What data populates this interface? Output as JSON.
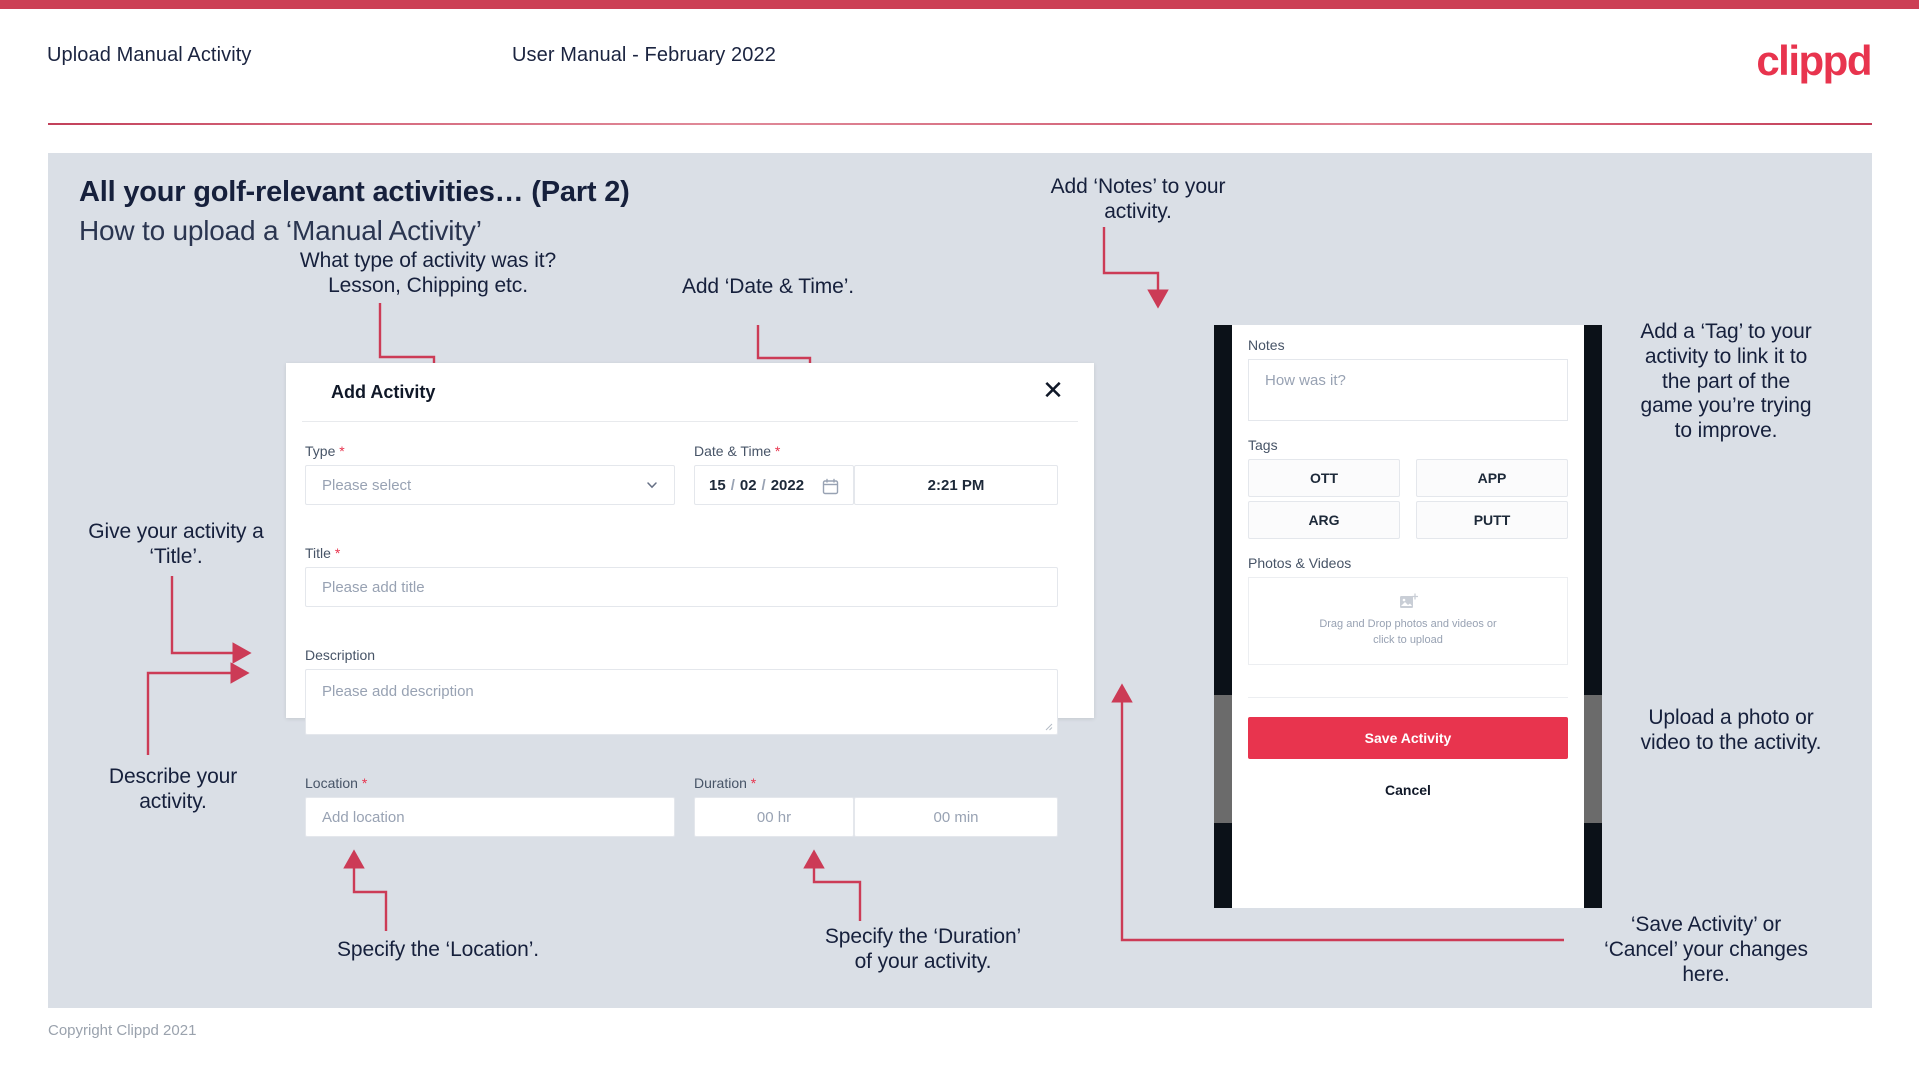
{
  "theme": {
    "accent": "#e8344e",
    "bar": "#cc4055",
    "slide_bg": "#dadfe6",
    "text_dark": "#16203c"
  },
  "header": {
    "title": "Upload Manual Activity",
    "subtitle": "User Manual - February 2022",
    "brand": "clippd"
  },
  "slide": {
    "title": "All your golf-relevant activities… (Part 2)",
    "subtitle": "How to upload a ‘Manual Activity’"
  },
  "annotations": {
    "type": "What type of activity was it?\nLesson, Chipping etc.",
    "type_l1": "What type of activity was it?",
    "type_l2": "Lesson, Chipping etc.",
    "datetime": "Add ‘Date & Time’.",
    "title_l1": "Give your activity a",
    "title_l2": "‘Title’.",
    "describe_l1": "Describe your",
    "describe_l2": "activity.",
    "location": "Specify the ‘Location’.",
    "duration_l1": "Specify the ‘Duration’",
    "duration_l2": "of your activity.",
    "notes_l1": "Add ‘Notes’ to your",
    "notes_l2": "activity.",
    "tag_l1": "Add a ‘Tag’ to your",
    "tag_l2": "activity to link it to",
    "tag_l3": "the part of the",
    "tag_l4": "game you’re trying",
    "tag_l5": "to improve.",
    "upload_l1": "Upload a photo or",
    "upload_l2": "video to the activity.",
    "save_l1": "‘Save Activity’ or",
    "save_l2": "‘Cancel’ your changes",
    "save_l3": "here."
  },
  "modal": {
    "title": "Add Activity",
    "close_icon": "close-icon",
    "fields": {
      "type": {
        "label": "Type",
        "required": true,
        "placeholder": "Please select"
      },
      "datetime": {
        "label": "Date & Time",
        "required": true,
        "day": "15",
        "month": "02",
        "year": "2022",
        "sep": "/",
        "time": "2:21 PM"
      },
      "title": {
        "label": "Title",
        "required": true,
        "placeholder": "Please add title"
      },
      "description": {
        "label": "Description",
        "required": false,
        "placeholder": "Please add description"
      },
      "location": {
        "label": "Location",
        "required": true,
        "placeholder": "Add location"
      },
      "duration": {
        "label": "Duration",
        "required": true,
        "hours_placeholder": "00 hr",
        "minutes_placeholder": "00 min"
      }
    }
  },
  "phone": {
    "notes": {
      "label": "Notes",
      "placeholder": "How was it?"
    },
    "tags": {
      "label": "Tags",
      "items": [
        "OTT",
        "APP",
        "ARG",
        "PUTT"
      ]
    },
    "photos": {
      "label": "Photos & Videos",
      "icon": "add-image-icon",
      "drop_l1": "Drag and Drop photos and videos or",
      "drop_l2": "click to upload"
    },
    "save_label": "Save Activity",
    "cancel_label": "Cancel"
  },
  "footer": {
    "copyright": "Copyright Clippd 2021"
  }
}
